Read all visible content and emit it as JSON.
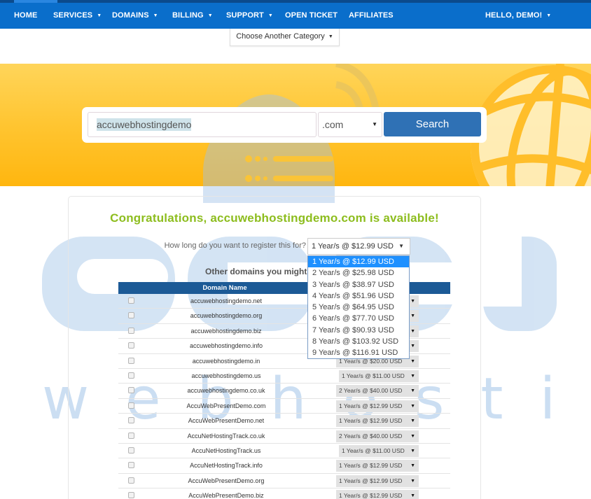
{
  "navbar": {
    "items": [
      {
        "label": "HOME",
        "has_caret": false
      },
      {
        "label": "SERVICES",
        "has_caret": true
      },
      {
        "label": "DOMAINS",
        "has_caret": true
      },
      {
        "label": "BILLING",
        "has_caret": true
      },
      {
        "label": "SUPPORT",
        "has_caret": true
      },
      {
        "label": "OPEN TICKET",
        "has_caret": false
      },
      {
        "label": "AFFILIATES",
        "has_caret": false
      }
    ],
    "user_menu": "HELLO, DEMO!",
    "caret": "▼"
  },
  "category_button": {
    "label": "Choose Another Category",
    "caret": "▼"
  },
  "search": {
    "query": "accuwebhostingdemo",
    "tld": ".com",
    "tld_arrow": "▼",
    "button_label": "Search"
  },
  "result": {
    "headline": "Congratulations, accuwebhostingdemo.com is available!",
    "register_label": "How long do you want to register this for?",
    "register_selected": "1 Year/s @ $12.99 USD",
    "select_arrow": "▼",
    "other_domains_heading": "Other domains you might be",
    "register_options": [
      "1 Year/s @ $12.99 USD",
      "2 Year/s @ $25.98 USD",
      "3 Year/s @ $38.97 USD",
      "4 Year/s @ $51.96 USD",
      "5 Year/s @ $64.95 USD",
      "6 Year/s @ $77.70 USD",
      "7 Year/s @ $90.93 USD",
      "8 Year/s @ $103.92 USD",
      "9 Year/s @ $116.91 USD"
    ],
    "highlighted_option_index": 0
  },
  "table": {
    "header": "Domain Name",
    "rows": [
      {
        "domain": "accuwebhostingdemo.net",
        "price": ""
      },
      {
        "domain": "accuwebhostingdemo.org",
        "price": ""
      },
      {
        "domain": "accuwebhostingdemo.biz",
        "price": ""
      },
      {
        "domain": "accuwebhostingdemo.info",
        "price": ""
      },
      {
        "domain": "accuwebhostingdemo.in",
        "price": "1 Year/s @ $20.00 USD"
      },
      {
        "domain": "accuwebhostingdemo.us",
        "price": "1 Year/s @ $11.00 USD"
      },
      {
        "domain": "accuwebhostingdemo.co.uk",
        "price": "2 Year/s @ $40.00 USD"
      },
      {
        "domain": "AccuWebPresentDemo.com",
        "price": "1 Year/s @ $12.99 USD"
      },
      {
        "domain": "AccuWebPresentDemo.net",
        "price": "1 Year/s @ $12.99 USD"
      },
      {
        "domain": "AccuNetHostingTrack.co.uk",
        "price": "2 Year/s @ $40.00 USD"
      },
      {
        "domain": "AccuNetHostingTrack.us",
        "price": "1 Year/s @ $11.00 USD"
      },
      {
        "domain": "AccuNetHostingTrack.info",
        "price": "1 Year/s @ $12.99 USD"
      },
      {
        "domain": "AccuWebPresentDemo.org",
        "price": "1 Year/s @ $12.99 USD"
      },
      {
        "domain": "AccuWebPresentDemo.biz",
        "price": "1 Year/s @ $12.99 USD"
      }
    ]
  },
  "watermark": {
    "line1": "accu",
    "line2": "webhosting"
  },
  "colors": {
    "nav_bg": "#0a6ecb",
    "accent_green": "#8dbd1e",
    "search_button": "#2f71b5",
    "table_header": "#1c5a96",
    "dropdown_highlight": "#1e90ff",
    "hero_yellow": "#ffc531"
  }
}
